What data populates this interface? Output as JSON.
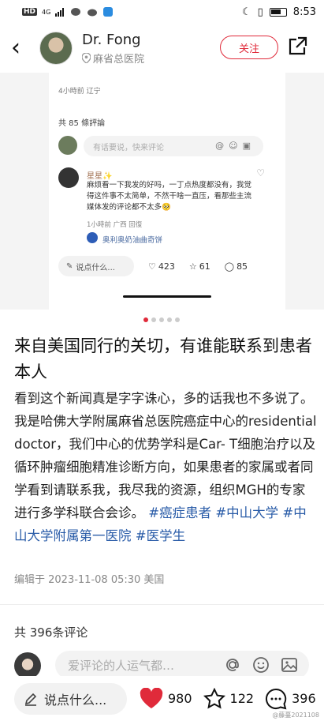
{
  "status_bar": {
    "network_badge": "HD",
    "network_type": "4G",
    "time": "8:53",
    "battery_icon": "battery-icon"
  },
  "header": {
    "name": "Dr. Fong",
    "location": "麻省总医院",
    "follow_label": "关注"
  },
  "embedded_screenshot": {
    "time_location": "4小時前 辽宁",
    "comment_count": "共 85 條評論",
    "input_placeholder": "有话要说，快来评论",
    "comment": {
      "author": "星星✨",
      "text": "麻烦看一下我发的好吗，一丁点热度都没有，我觉得这件事不太简单，不然干啥一直压，看那些主流媒体发的评论都不太多🥺",
      "meta": "1小時前 广西  回復"
    },
    "reply_author": "奥利奥奶油曲奇饼",
    "say_label": "说点什么...",
    "likes": "423",
    "favs": "61",
    "comments": "85"
  },
  "post": {
    "title": "来自美国同行的关切，有谁能联系到患者本人",
    "body": "看到这个新闻真是字字诛心，多的话我也不多说了。我是哈佛大学附属麻省总医院癌症中心的residential doctor，我们中心的优势学科是Car- T细胞治疗以及循环肿瘤细胞精准诊断方向，如果患者的家属或者同学看到请联系我，我尽我的资源，组织MGH的专家进行多学科联合会诊。",
    "tags": [
      "#癌症患者",
      "#中山大学",
      "#中山大学附属第一医院",
      "#医学生"
    ],
    "edited": "编辑于 2023-11-08 05:30 美国"
  },
  "comments": {
    "count_label": "共 396条评论",
    "input_placeholder": "爱评论的人运气都…"
  },
  "bottom_bar": {
    "say_label": "说点什么...",
    "likes": "980",
    "favs": "122",
    "comments": "396"
  },
  "watermark": "@藤蔓2021108",
  "colors": {
    "accent": "#e02a3a",
    "tag": "#2a5ca8"
  }
}
